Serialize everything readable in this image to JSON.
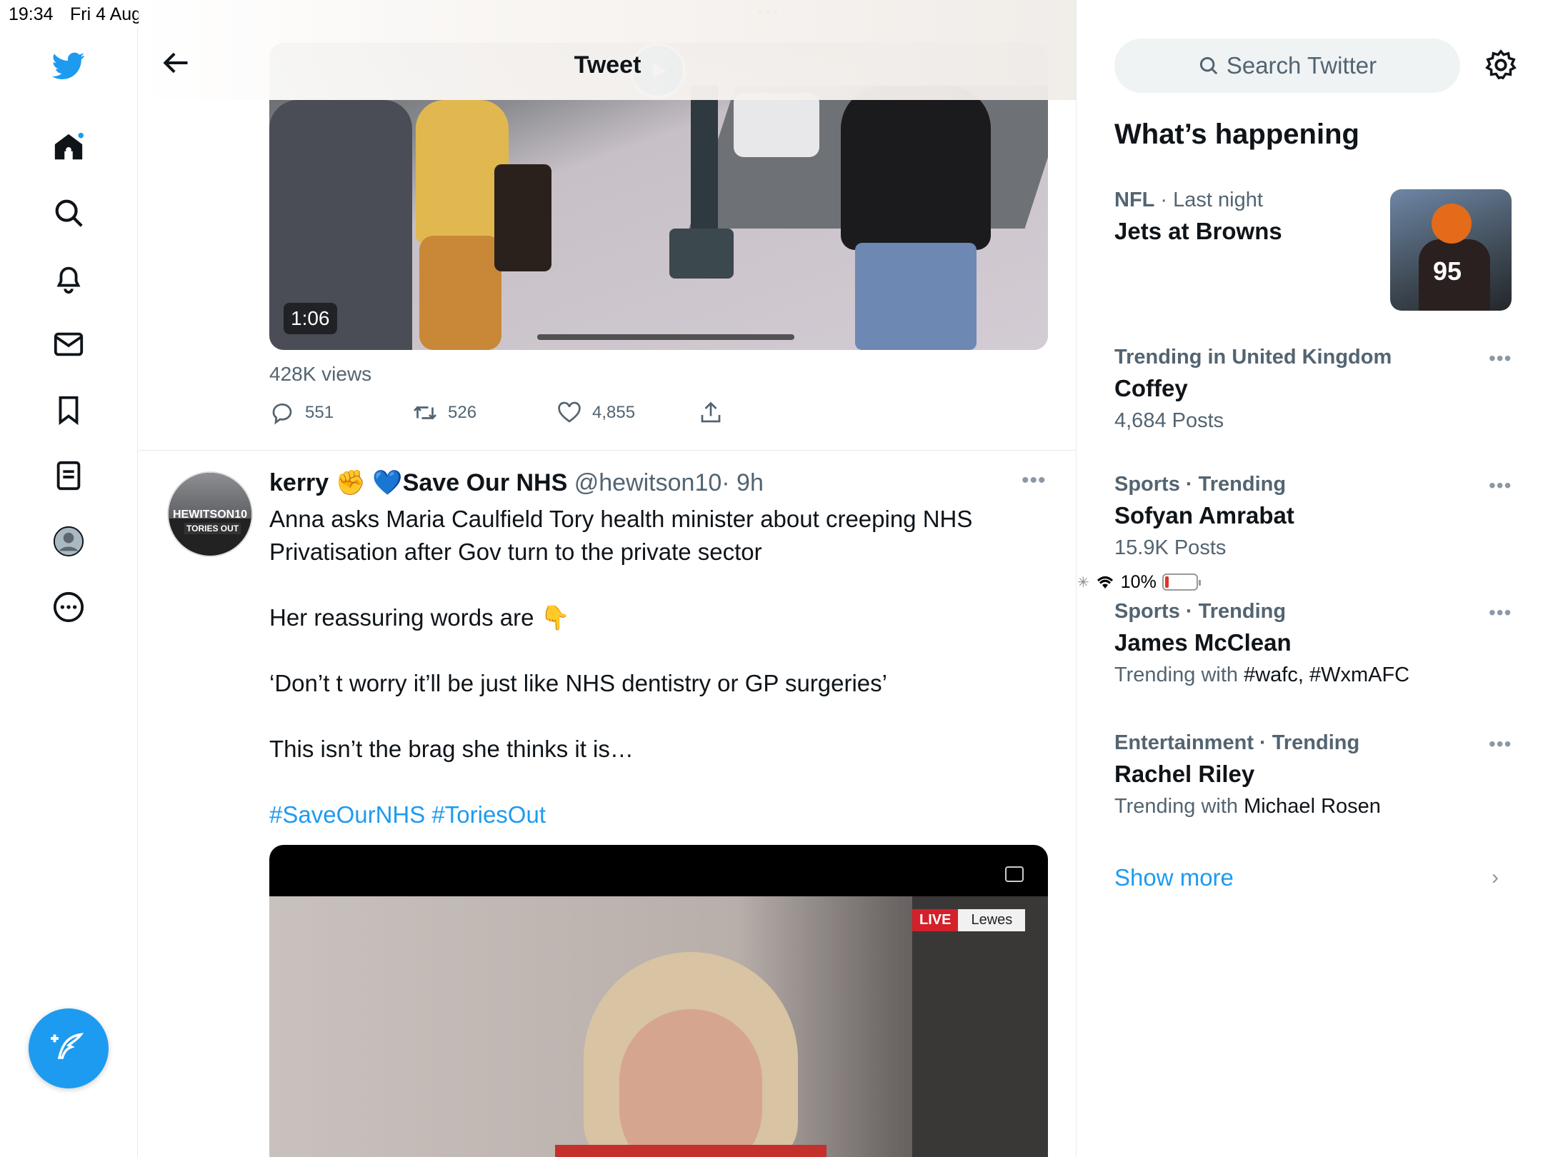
{
  "status_bar": {
    "time": "19:34",
    "date": "Fri 4 Aug",
    "battery": "10%"
  },
  "header": {
    "title": "Tweet"
  },
  "video1": {
    "duration": "1:06",
    "views": "428K views"
  },
  "actions": {
    "replies": "551",
    "retweets": "526",
    "likes": "4,855"
  },
  "tweet": {
    "name": "kerry ✊ 💙Save Our NHS",
    "handle": "@hewitson10",
    "time": "· 9h",
    "lines": [
      "Anna asks Maria Caulfield Tory health minister about creeping NHS",
      "Privatisation after Gov turn to the private sector",
      "Her reassuring words are  👇",
      "‘Don’t t worry it’ll be just like NHS dentistry or GP surgeries’",
      "This isn’t the brag she thinks it is…"
    ],
    "hashtags": "#SaveOurNHS #ToriesOut",
    "avatar_text1": "HEWITSON10",
    "avatar_text2": "TORIES OUT",
    "video_live": "LIVE",
    "video_location": "Lewes"
  },
  "right": {
    "search_placeholder": "Search Twitter",
    "section_title": "What’s happening",
    "trends": [
      {
        "category": "NFL",
        "meta": " · Last night",
        "title": "Jets at Browns",
        "sub": "",
        "sub_dark": ""
      },
      {
        "category": "Trending in United Kingdom",
        "meta": "",
        "title": "Coffey",
        "sub": "4,684 Posts",
        "sub_dark": ""
      },
      {
        "category": "Sports · Trending",
        "meta": "",
        "title": "Sofyan Amrabat",
        "sub": "15.9K Posts",
        "sub_dark": ""
      },
      {
        "category": "Sports · Trending",
        "meta": "",
        "title": "James McClean",
        "sub": "Trending with ",
        "sub_dark": "#wafc, #WxmAFC"
      },
      {
        "category": "Entertainment · Trending",
        "meta": "",
        "title": "Rachel Riley",
        "sub": "Trending with ",
        "sub_dark": "Michael Rosen"
      }
    ],
    "show_more": "Show more",
    "thumb_number": "95"
  },
  "colors": {
    "accent": "#1d9bf0",
    "text": "#0f1419",
    "muted": "#536471"
  }
}
